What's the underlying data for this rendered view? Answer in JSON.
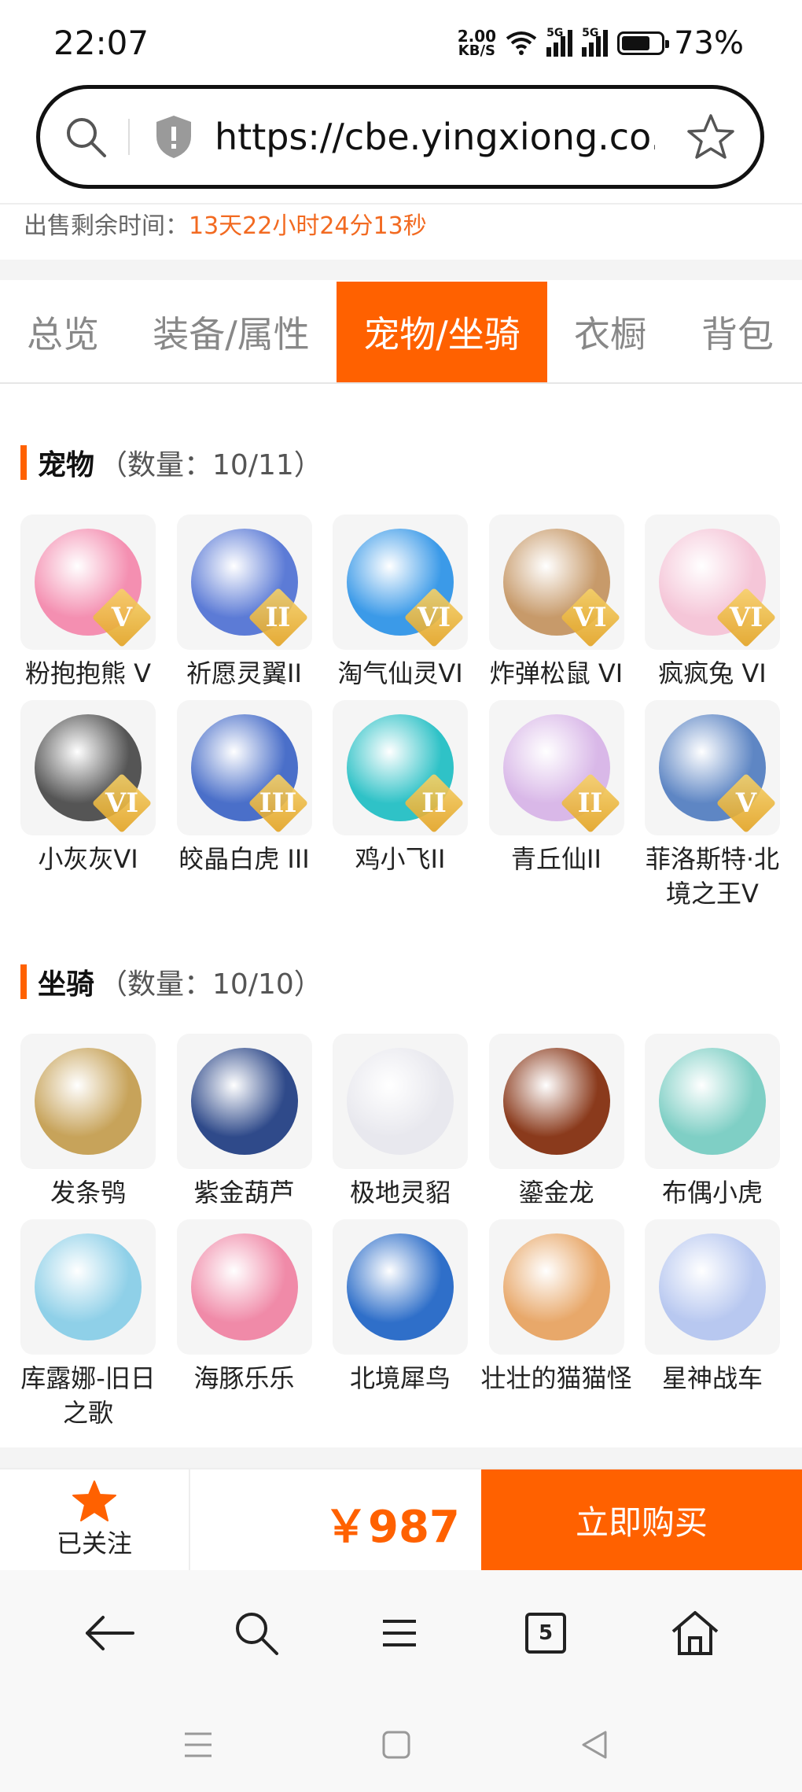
{
  "status_bar": {
    "time": "22:07",
    "net_speed_value": "2.00",
    "net_speed_unit": "KB/S",
    "signal_label_1": "5G",
    "signal_label_2": "5G",
    "battery_text": "73%",
    "battery_level": 0.73
  },
  "browser": {
    "url": "https://cbe.yingxiong.co..."
  },
  "listing": {
    "sale_time_label": "出售剩余时间：",
    "sale_time_value": "13天22小时24分13秒"
  },
  "tabs": [
    {
      "label": "总览",
      "active": false
    },
    {
      "label": "装备/属性",
      "active": false
    },
    {
      "label": "宠物/坐骑",
      "active": true
    },
    {
      "label": "衣橱",
      "active": false
    },
    {
      "label": "背包",
      "active": false
    }
  ],
  "pets": {
    "title": "宠物",
    "count": "（数量：10/11）",
    "items": [
      {
        "name": "粉抱抱熊 V",
        "grade": "V",
        "color": "#f48fb1"
      },
      {
        "name": "祈愿灵翼II",
        "grade": "II",
        "color": "#5c7bd6"
      },
      {
        "name": "淘气仙灵VI",
        "grade": "VI",
        "color": "#3b9ae8"
      },
      {
        "name": "炸弹松鼠 VI",
        "grade": "VI",
        "color": "#c79a6a"
      },
      {
        "name": "疯疯兔 VI",
        "grade": "VI",
        "color": "#f5c6d8"
      },
      {
        "name": "小灰灰VI",
        "grade": "VI",
        "color": "#555555"
      },
      {
        "name": "皎晶白虎 III",
        "grade": "III",
        "color": "#4a6fc9"
      },
      {
        "name": "鸡小飞II",
        "grade": "II",
        "color": "#2fc2c7"
      },
      {
        "name": "青丘仙II",
        "grade": "II",
        "color": "#d9b8e8"
      },
      {
        "name": "菲洛斯特·北境之王V",
        "grade": "V",
        "color": "#5e86c4"
      }
    ]
  },
  "mounts": {
    "title": "坐骑",
    "count": "（数量：10/10）",
    "items": [
      {
        "name": "发条鸮",
        "color": "#c7a35a"
      },
      {
        "name": "紫金葫芦",
        "color": "#2f4a8a"
      },
      {
        "name": "极地灵貂",
        "color": "#e8e8ee"
      },
      {
        "name": "鎏金龙",
        "color": "#8a3a1c"
      },
      {
        "name": "布偶小虎",
        "color": "#7fcfc5"
      },
      {
        "name": "库露娜-旧日之歌",
        "color": "#8fd0e8"
      },
      {
        "name": "海豚乐乐",
        "color": "#f08aa8"
      },
      {
        "name": "北境犀鸟",
        "color": "#2f6fc9"
      },
      {
        "name": "壮壮的猫猫怪",
        "color": "#e8a86a"
      },
      {
        "name": "星神战车",
        "color": "#b8c8f0"
      }
    ]
  },
  "action_bar": {
    "follow_label": "已关注",
    "price": "￥987",
    "buy_label": "立即购买",
    "accent": "#ff6100"
  },
  "browser_bar": {
    "tab_count": "5"
  }
}
